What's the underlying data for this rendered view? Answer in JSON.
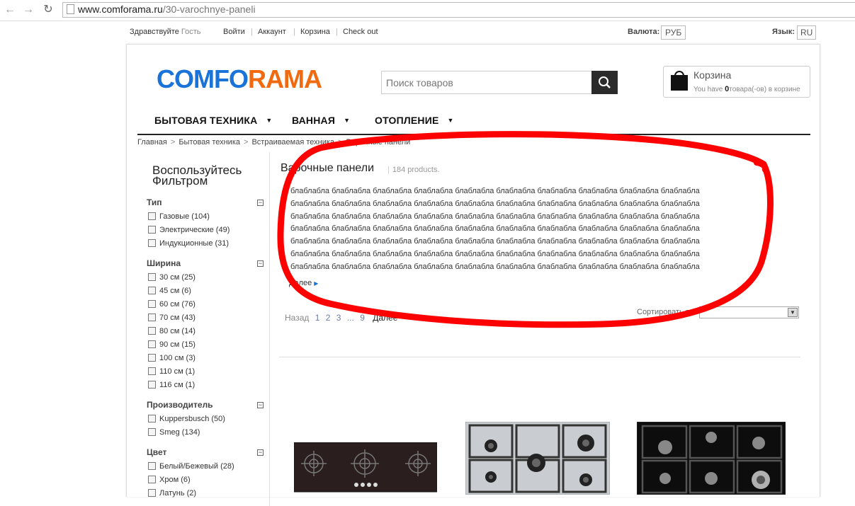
{
  "browser": {
    "url_domain": "www.comforama.ru",
    "url_path": "/30-varochnye-paneli"
  },
  "topbar": {
    "greeting": "Здравствуйте",
    "guest": "Гость",
    "login": "Войти",
    "account": "Аккаунт",
    "cart": "Корзина",
    "checkout": "Check out",
    "currency_label": "Валюта:",
    "currency_value": "РУБ",
    "language_label": "Язык:",
    "language_value": "RU"
  },
  "header": {
    "logo_part1": "COMFO",
    "logo_part2": "RAMA",
    "search_placeholder": "Поиск товаров",
    "cart_title": "Корзина",
    "cart_you_have": "You have",
    "cart_count": "0",
    "cart_suffix": "товара(-ов) в корзине"
  },
  "menu": {
    "items": [
      "БЫТОВАЯ ТЕХНИКА",
      "ВАННАЯ",
      "ОТОПЛЕНИЕ"
    ]
  },
  "breadcrumb": [
    "Главная",
    "Бытовая техника",
    "Встраиваемая техника",
    "Варочные панели"
  ],
  "sidebar": {
    "title": "Воспользуйтесь Фильтром",
    "groups": [
      {
        "title": "Тип",
        "items": [
          "Газовые (104)",
          "Электрические (49)",
          "Индукционные (31)"
        ]
      },
      {
        "title": "Ширина",
        "items": [
          "30 см (25)",
          "45 см (6)",
          "60 см (76)",
          "70 см (43)",
          "80 см (14)",
          "90 см (15)",
          "100 см (3)",
          "110 см (1)",
          "116 см (1)"
        ]
      },
      {
        "title": "Производитель",
        "items": [
          "Kuppersbusch (50)",
          "Smeg (134)"
        ]
      },
      {
        "title": "Цвет",
        "items": [
          "Белый/Бежевый (28)",
          "Хром (6)",
          "Латунь (2)"
        ]
      }
    ]
  },
  "category": {
    "title": "Варочные панели",
    "count": "184 products.",
    "description_word": "блаблабла",
    "description_lines": 7,
    "more": "Далее"
  },
  "pager": {
    "prev": "Назад",
    "pages": [
      "1",
      "2",
      "3",
      "...",
      "9"
    ],
    "next": "Далее"
  },
  "sort": {
    "label": "Сортировать по",
    "value": ""
  },
  "colors": {
    "logo_blue": "#1a73d9",
    "logo_orange": "#f26a10",
    "annotation_red": "#ff0000"
  }
}
